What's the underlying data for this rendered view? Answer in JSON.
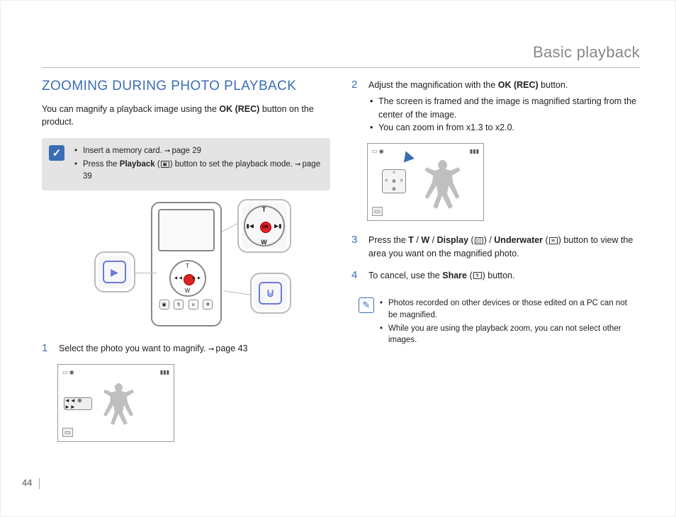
{
  "header": {
    "section": "Basic playback"
  },
  "page_number": "44",
  "left": {
    "title": "ZOOMING DURING PHOTO PLAYBACK",
    "intro_before": "You can magnify a playback image using the ",
    "intro_bold": "OK (REC)",
    "intro_after": " button on the product.",
    "prereq": {
      "items": [
        {
          "text_before": "Insert a memory card. ",
          "ref": "page 29"
        },
        {
          "text_before": "Press the ",
          "bold": "Playback",
          "text_mid": " (",
          "icon": "▣",
          "text_after": ") button to set the playback mode. ",
          "ref": "page 39"
        }
      ]
    },
    "device": {
      "dpad": {
        "t": "T",
        "w": "W",
        "left": "◄◄",
        "right": "►►",
        "ok": "OK"
      },
      "row": [
        "▣",
        "↯",
        "⊍",
        "❄"
      ]
    },
    "step1": {
      "num": "1",
      "text_before": "Select the photo you want to magnify. ",
      "ref": "page 43"
    },
    "screen1": {
      "tl": "▭ ◉",
      "tr": "▮▮▮",
      "badge": "◄◄ ⊕ ►►",
      "bottom": "▭"
    }
  },
  "right": {
    "step2": {
      "num": "2",
      "text_before": "Adjust the magnification with the ",
      "bold": "OK (REC)",
      "text_after": " button.",
      "bullets": [
        "The screen is framed and the image is magnified starting from the center of the image.",
        "You can zoom in from x1.3 to x2.0."
      ]
    },
    "screen2": {
      "tl": "▭ ◉",
      "tr": "▮▮▮",
      "nav": {
        "t": "^",
        "b": "⊕",
        "l": "<",
        "r": ">",
        "c": "⊕"
      },
      "bottom": "▭"
    },
    "step3": {
      "num": "3",
      "before": "Press the ",
      "b1": "T",
      "s1": " / ",
      "b2": "W",
      "s2": " / ",
      "b3": "Display",
      "mid1": " (",
      "icon1": "|▯|",
      "mid2": ") / ",
      "b4": "Underwater",
      "mid3": " (",
      "icon2": "≋",
      "after": ") button to view the area you want on the magnified photo."
    },
    "step4": {
      "num": "4",
      "before": "To cancel, use the ",
      "bold": "Share",
      "mid": " (",
      "icon": "↯",
      "after": ") button."
    },
    "notes": {
      "items": [
        "Photos recorded on other devices or those edited on a PC can not be magnified.",
        "While you are using the playback zoom, you can not select other images."
      ]
    }
  }
}
